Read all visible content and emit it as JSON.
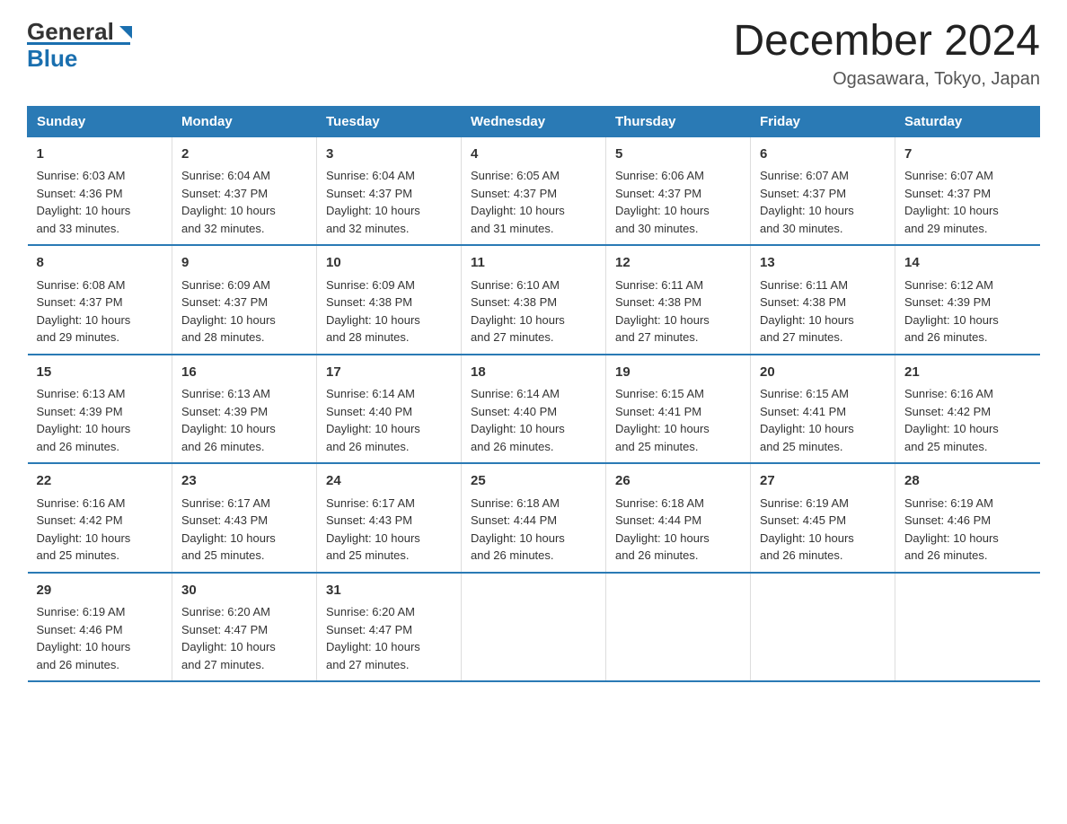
{
  "header": {
    "logo_general": "General",
    "logo_blue": "Blue",
    "title": "December 2024",
    "subtitle": "Ogasawara, Tokyo, Japan"
  },
  "days_of_week": [
    "Sunday",
    "Monday",
    "Tuesday",
    "Wednesday",
    "Thursday",
    "Friday",
    "Saturday"
  ],
  "weeks": [
    [
      {
        "day": "1",
        "sunrise": "6:03 AM",
        "sunset": "4:36 PM",
        "daylight": "10 hours and 33 minutes."
      },
      {
        "day": "2",
        "sunrise": "6:04 AM",
        "sunset": "4:37 PM",
        "daylight": "10 hours and 32 minutes."
      },
      {
        "day": "3",
        "sunrise": "6:04 AM",
        "sunset": "4:37 PM",
        "daylight": "10 hours and 32 minutes."
      },
      {
        "day": "4",
        "sunrise": "6:05 AM",
        "sunset": "4:37 PM",
        "daylight": "10 hours and 31 minutes."
      },
      {
        "day": "5",
        "sunrise": "6:06 AM",
        "sunset": "4:37 PM",
        "daylight": "10 hours and 30 minutes."
      },
      {
        "day": "6",
        "sunrise": "6:07 AM",
        "sunset": "4:37 PM",
        "daylight": "10 hours and 30 minutes."
      },
      {
        "day": "7",
        "sunrise": "6:07 AM",
        "sunset": "4:37 PM",
        "daylight": "10 hours and 29 minutes."
      }
    ],
    [
      {
        "day": "8",
        "sunrise": "6:08 AM",
        "sunset": "4:37 PM",
        "daylight": "10 hours and 29 minutes."
      },
      {
        "day": "9",
        "sunrise": "6:09 AM",
        "sunset": "4:37 PM",
        "daylight": "10 hours and 28 minutes."
      },
      {
        "day": "10",
        "sunrise": "6:09 AM",
        "sunset": "4:38 PM",
        "daylight": "10 hours and 28 minutes."
      },
      {
        "day": "11",
        "sunrise": "6:10 AM",
        "sunset": "4:38 PM",
        "daylight": "10 hours and 27 minutes."
      },
      {
        "day": "12",
        "sunrise": "6:11 AM",
        "sunset": "4:38 PM",
        "daylight": "10 hours and 27 minutes."
      },
      {
        "day": "13",
        "sunrise": "6:11 AM",
        "sunset": "4:38 PM",
        "daylight": "10 hours and 27 minutes."
      },
      {
        "day": "14",
        "sunrise": "6:12 AM",
        "sunset": "4:39 PM",
        "daylight": "10 hours and 26 minutes."
      }
    ],
    [
      {
        "day": "15",
        "sunrise": "6:13 AM",
        "sunset": "4:39 PM",
        "daylight": "10 hours and 26 minutes."
      },
      {
        "day": "16",
        "sunrise": "6:13 AM",
        "sunset": "4:39 PM",
        "daylight": "10 hours and 26 minutes."
      },
      {
        "day": "17",
        "sunrise": "6:14 AM",
        "sunset": "4:40 PM",
        "daylight": "10 hours and 26 minutes."
      },
      {
        "day": "18",
        "sunrise": "6:14 AM",
        "sunset": "4:40 PM",
        "daylight": "10 hours and 26 minutes."
      },
      {
        "day": "19",
        "sunrise": "6:15 AM",
        "sunset": "4:41 PM",
        "daylight": "10 hours and 25 minutes."
      },
      {
        "day": "20",
        "sunrise": "6:15 AM",
        "sunset": "4:41 PM",
        "daylight": "10 hours and 25 minutes."
      },
      {
        "day": "21",
        "sunrise": "6:16 AM",
        "sunset": "4:42 PM",
        "daylight": "10 hours and 25 minutes."
      }
    ],
    [
      {
        "day": "22",
        "sunrise": "6:16 AM",
        "sunset": "4:42 PM",
        "daylight": "10 hours and 25 minutes."
      },
      {
        "day": "23",
        "sunrise": "6:17 AM",
        "sunset": "4:43 PM",
        "daylight": "10 hours and 25 minutes."
      },
      {
        "day": "24",
        "sunrise": "6:17 AM",
        "sunset": "4:43 PM",
        "daylight": "10 hours and 25 minutes."
      },
      {
        "day": "25",
        "sunrise": "6:18 AM",
        "sunset": "4:44 PM",
        "daylight": "10 hours and 26 minutes."
      },
      {
        "day": "26",
        "sunrise": "6:18 AM",
        "sunset": "4:44 PM",
        "daylight": "10 hours and 26 minutes."
      },
      {
        "day": "27",
        "sunrise": "6:19 AM",
        "sunset": "4:45 PM",
        "daylight": "10 hours and 26 minutes."
      },
      {
        "day": "28",
        "sunrise": "6:19 AM",
        "sunset": "4:46 PM",
        "daylight": "10 hours and 26 minutes."
      }
    ],
    [
      {
        "day": "29",
        "sunrise": "6:19 AM",
        "sunset": "4:46 PM",
        "daylight": "10 hours and 26 minutes."
      },
      {
        "day": "30",
        "sunrise": "6:20 AM",
        "sunset": "4:47 PM",
        "daylight": "10 hours and 27 minutes."
      },
      {
        "day": "31",
        "sunrise": "6:20 AM",
        "sunset": "4:47 PM",
        "daylight": "10 hours and 27 minutes."
      },
      {
        "day": "",
        "sunrise": "",
        "sunset": "",
        "daylight": ""
      },
      {
        "day": "",
        "sunrise": "",
        "sunset": "",
        "daylight": ""
      },
      {
        "day": "",
        "sunrise": "",
        "sunset": "",
        "daylight": ""
      },
      {
        "day": "",
        "sunrise": "",
        "sunset": "",
        "daylight": ""
      }
    ]
  ],
  "labels": {
    "sunrise": "Sunrise:",
    "sunset": "Sunset:",
    "daylight": "Daylight:"
  },
  "colors": {
    "header_bg": "#2a7ab5",
    "header_text": "#ffffff",
    "border": "#2a7ab5"
  }
}
